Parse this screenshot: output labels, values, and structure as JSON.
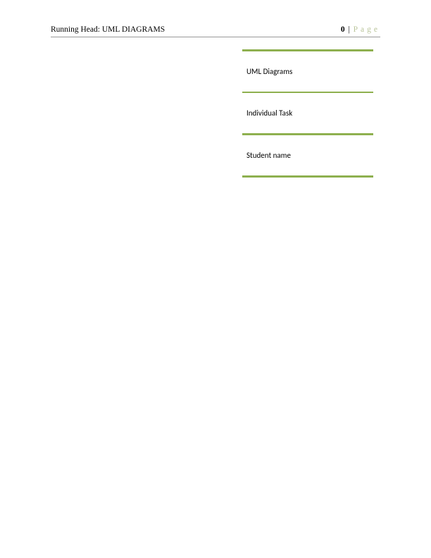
{
  "header": {
    "running_head": "Running Head: UML DIAGRAMS",
    "page_number": "0",
    "page_separator": "|",
    "page_word": "Page"
  },
  "title_block": {
    "line1": "UML Diagrams",
    "line2": "Individual Task",
    "line3": "Student name"
  }
}
